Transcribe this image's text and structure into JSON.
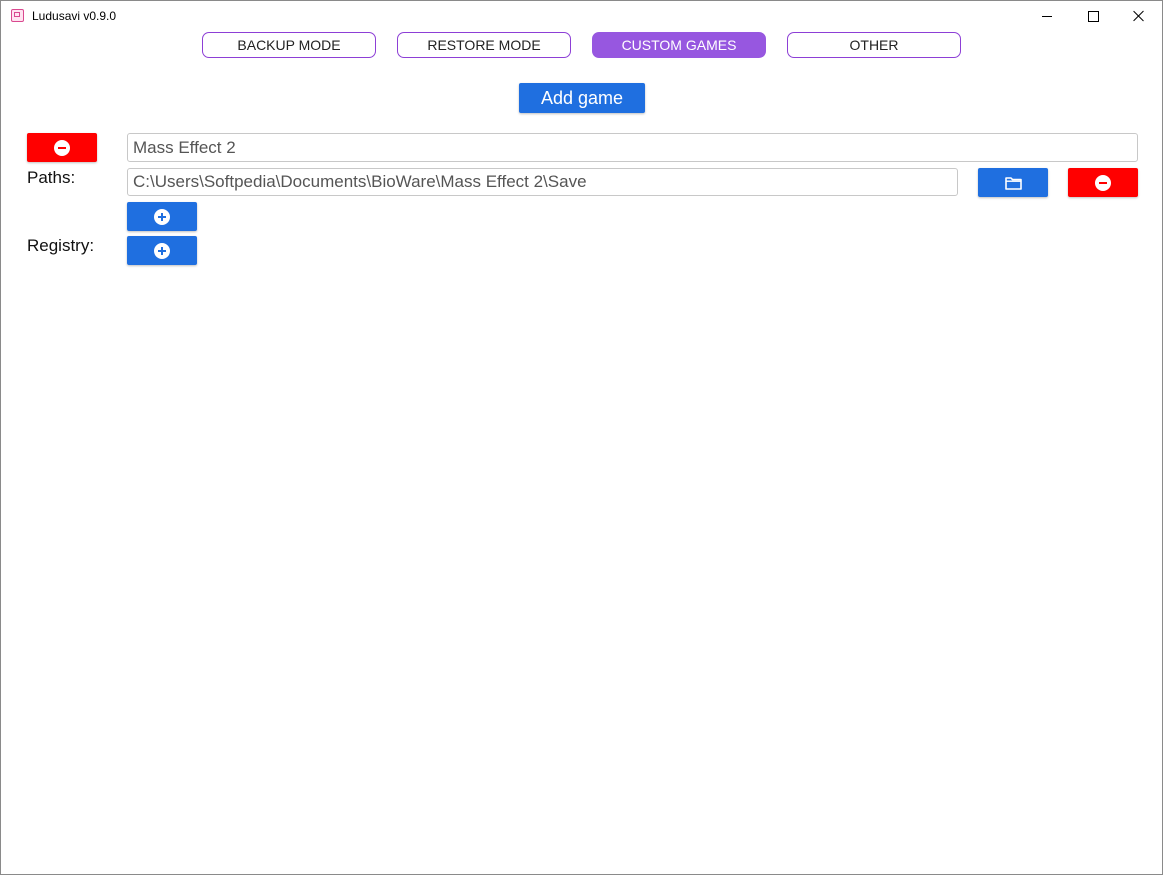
{
  "window": {
    "title": "Ludusavi v0.9.0",
    "icon": "ludusavi-app-icon"
  },
  "colors": {
    "accent_purple": "#9757e0",
    "tab_border": "#8d3fd6",
    "primary_blue": "#1f6fe0",
    "danger_red": "#ff0000"
  },
  "tabs": [
    {
      "label": "BACKUP MODE",
      "active": false
    },
    {
      "label": "RESTORE MODE",
      "active": false
    },
    {
      "label": "CUSTOM GAMES",
      "active": true
    },
    {
      "label": "OTHER",
      "active": false
    }
  ],
  "actions": {
    "add_game_label": "Add game"
  },
  "game": {
    "name": "Mass Effect 2",
    "remove_icon": "minus-circle-icon",
    "paths_label": "Paths:",
    "paths": [
      {
        "value": "C:\\Users\\Softpedia\\Documents\\BioWare\\Mass Effect 2\\Save",
        "browse_icon": "folder-icon",
        "remove_icon": "minus-circle-icon"
      }
    ],
    "add_path_icon": "plus-circle-icon",
    "registry_label": "Registry:",
    "add_registry_icon": "plus-circle-icon"
  }
}
